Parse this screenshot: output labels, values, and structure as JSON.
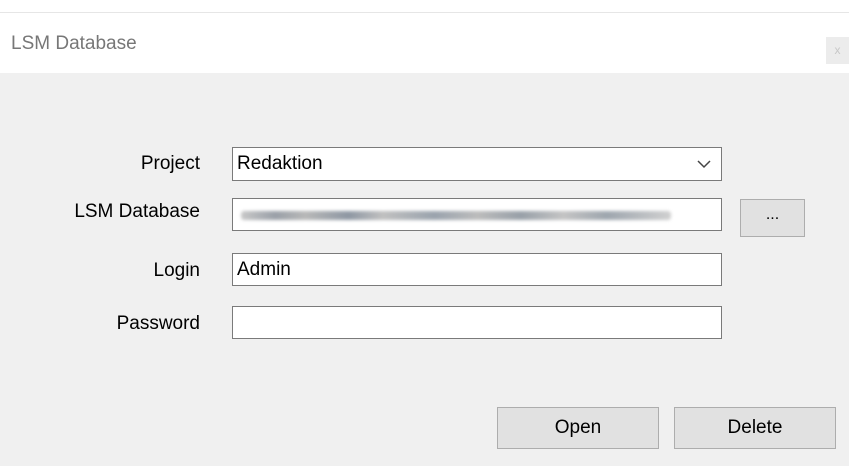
{
  "window": {
    "title": "LSM Database",
    "close_label": "x"
  },
  "form": {
    "project_label": "Project",
    "project_value": "Redaktion",
    "database_label": "LSM Database",
    "browse_label": "...",
    "login_label": "Login",
    "login_value": "Admin",
    "password_label": "Password",
    "password_value": ""
  },
  "buttons": {
    "open_label": "Open",
    "delete_label": "Delete"
  },
  "icons": {
    "combo_arrow": "chevron-down-icon",
    "close": "close-icon"
  }
}
